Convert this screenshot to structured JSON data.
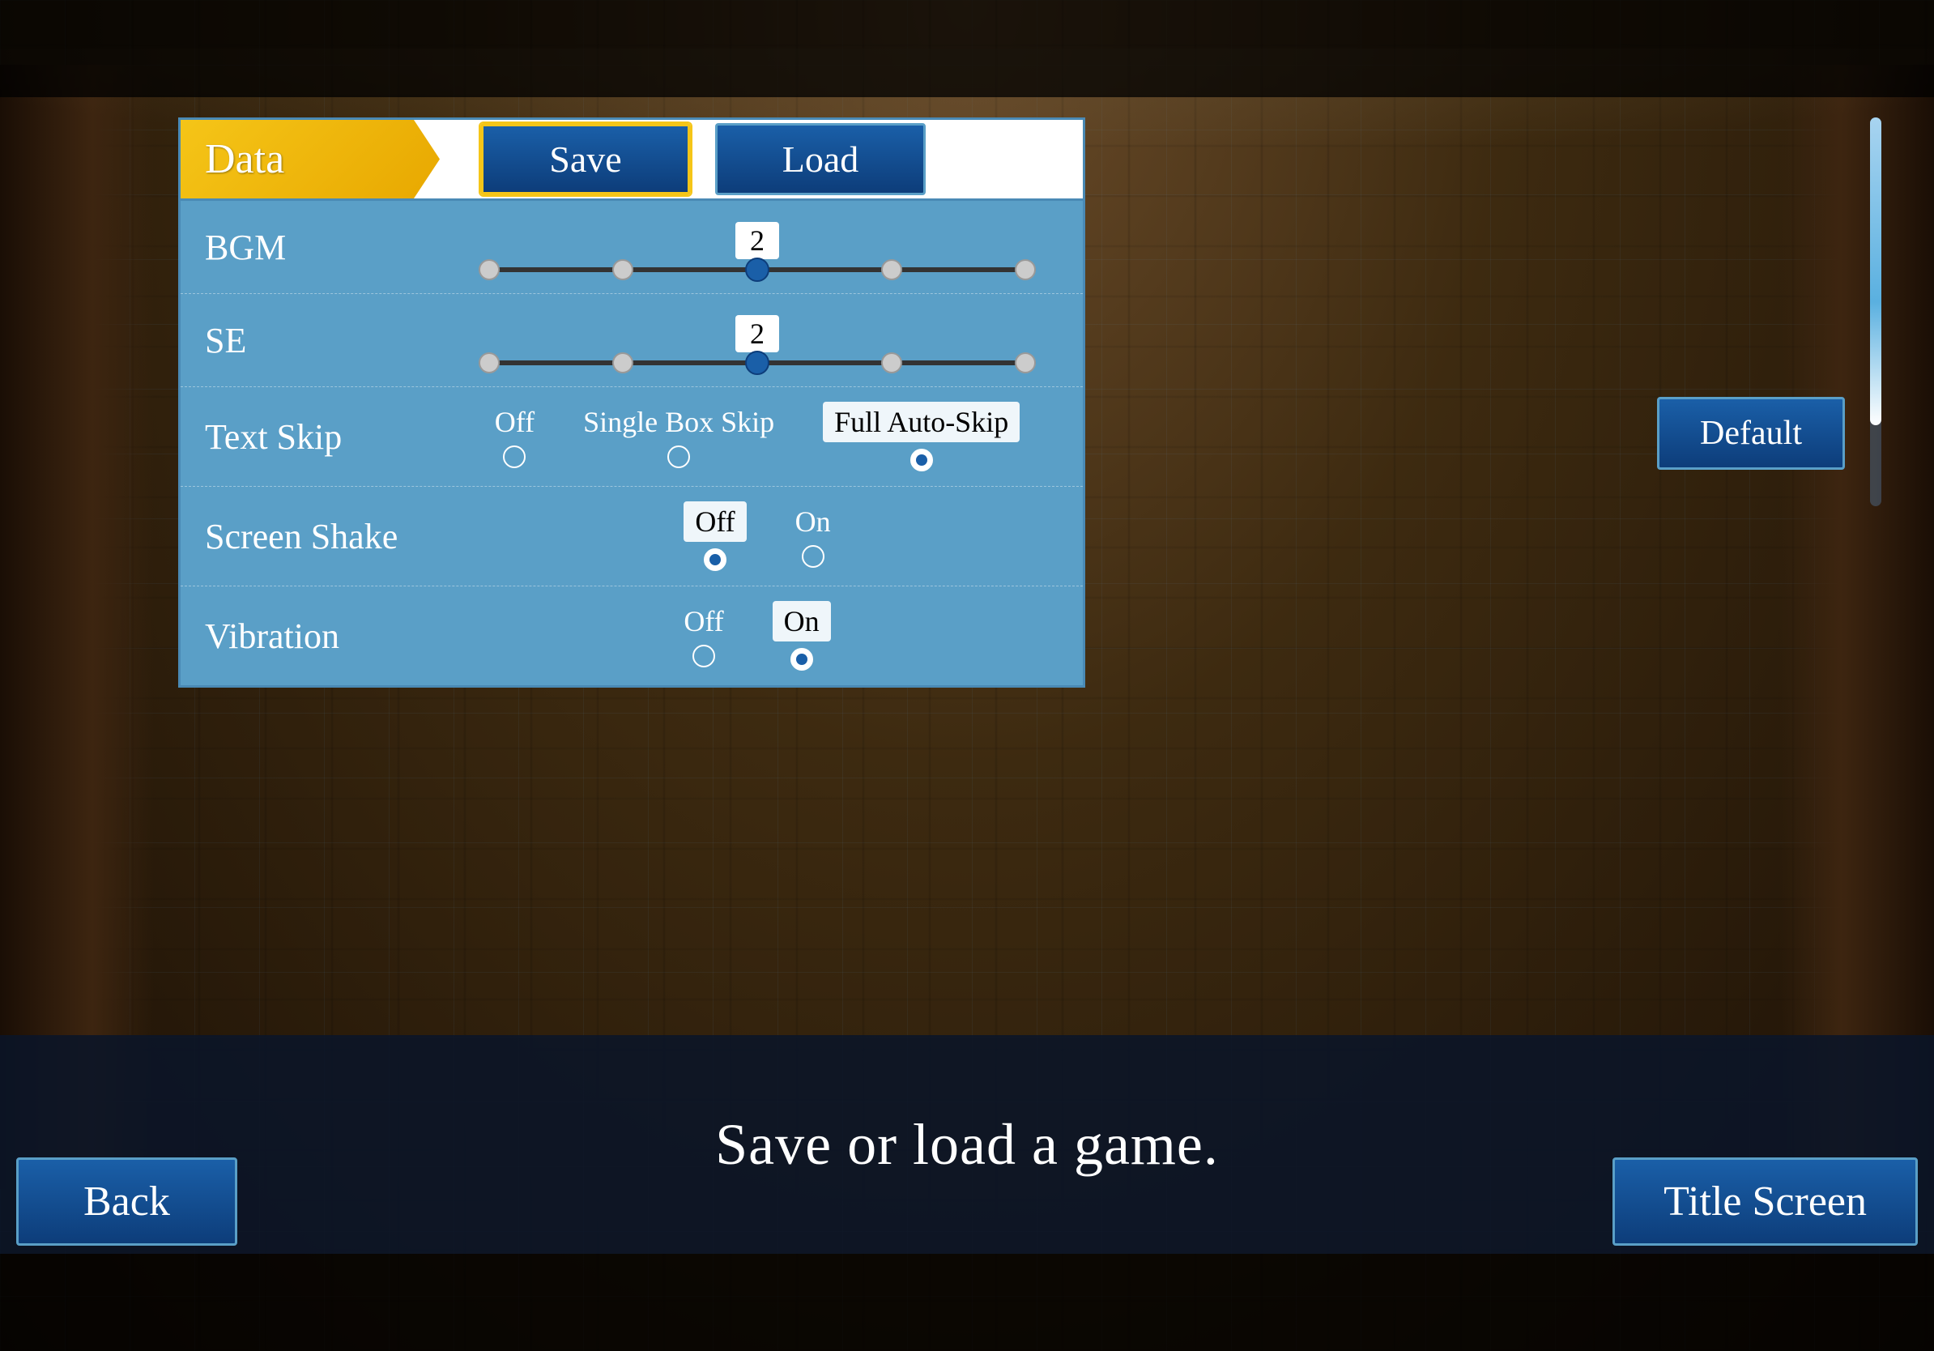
{
  "background": {
    "color": "#2a1a08"
  },
  "header": {
    "data_label": "Data",
    "save_label": "Save",
    "load_label": "Load"
  },
  "settings": {
    "bgm": {
      "label": "BGM",
      "value": 2,
      "dots": 5,
      "active_dot": 2
    },
    "se": {
      "label": "SE",
      "value": 2,
      "dots": 5,
      "active_dot": 2
    },
    "text_skip": {
      "label": "Text Skip",
      "options": [
        "Off",
        "Single Box Skip",
        "Full Auto-Skip"
      ],
      "selected": 2
    },
    "screen_shake": {
      "label": "Screen Shake",
      "options": [
        "Off",
        "On"
      ],
      "selected": 0
    },
    "vibration": {
      "label": "Vibration",
      "options": [
        "Off",
        "On"
      ],
      "selected": 1
    }
  },
  "default_button": "Default",
  "status_text": "Save or load a game.",
  "nav": {
    "back": "Back",
    "title_screen": "Title Screen"
  }
}
